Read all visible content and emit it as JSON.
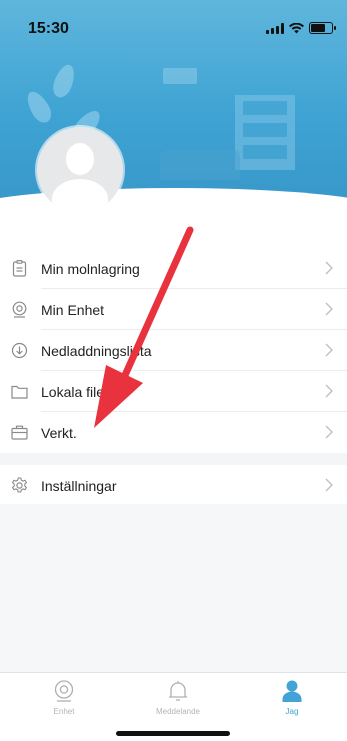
{
  "status_bar": {
    "time": "15:30",
    "battery_fill": 0.8
  },
  "menu": {
    "items": [
      {
        "label": "Min molnlagring",
        "icon": "cloud-storage-icon"
      },
      {
        "label": "Min Enhet",
        "icon": "camera-device-icon"
      },
      {
        "label": "Nedladdningslista",
        "icon": "download-icon"
      },
      {
        "label": "Lokala filer",
        "icon": "folder-icon"
      },
      {
        "label": "Verkt.",
        "icon": "toolbox-icon"
      }
    ],
    "settings": {
      "label": "Inställningar",
      "icon": "gear-icon"
    }
  },
  "tabbar": {
    "tabs": [
      {
        "label": "Enhet",
        "icon": "camera-icon",
        "active": false
      },
      {
        "label": "Meddelande",
        "icon": "bell-icon",
        "active": false
      },
      {
        "label": "Jag",
        "icon": "person-icon",
        "active": true
      }
    ]
  },
  "colors": {
    "accent": "#42a4d6",
    "header": "#3ea3d3",
    "annotation_arrow": "#e8333f"
  }
}
